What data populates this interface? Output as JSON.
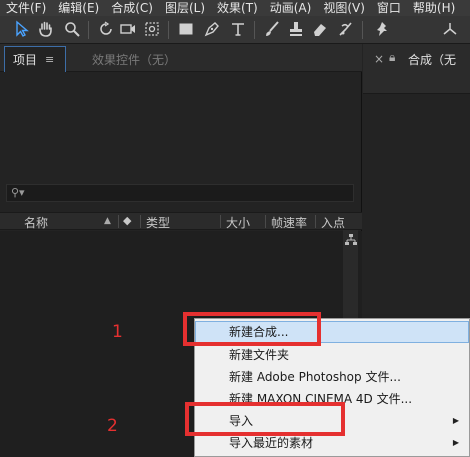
{
  "menubar": {
    "items": [
      {
        "label": "文件(F)"
      },
      {
        "label": "编辑(E)"
      },
      {
        "label": "合成(C)"
      },
      {
        "label": "图层(L)"
      },
      {
        "label": "效果(T)"
      },
      {
        "label": "动画(A)"
      },
      {
        "label": "视图(V)"
      },
      {
        "label": "窗口"
      },
      {
        "label": "帮助(H)"
      }
    ]
  },
  "toolbar": {
    "tools": [
      "selection-tool-icon",
      "hand-tool-icon",
      "zoom-tool-icon",
      "rotate-tool-icon",
      "camera-tool-icon",
      "pan-behind-tool-icon",
      "rectangle-tool-icon",
      "pen-tool-icon",
      "text-tool-icon",
      "brush-tool-icon",
      "clone-stamp-tool-icon",
      "eraser-tool-icon",
      "roto-brush-tool-icon",
      "puppet-pin-tool-icon",
      "axis-icon"
    ]
  },
  "project_panel": {
    "tab_project": "项目",
    "tab_effects": "效果控件（无）",
    "columns": {
      "name": "名称",
      "type": "类型",
      "size": "大小",
      "framerate": "帧速率",
      "inpoint": "入点"
    }
  },
  "comp_panel": {
    "tab_label": "合成（无"
  },
  "context_menu": {
    "items": [
      {
        "label": "新建合成..."
      },
      {
        "label": "新建文件夹"
      },
      {
        "label": "新建 Adobe Photoshop 文件..."
      },
      {
        "label": "新建 MAXON CINEMA 4D 文件..."
      },
      {
        "label": "导入"
      },
      {
        "label": "导入最近的素材"
      }
    ]
  },
  "annotations": {
    "step1": "1",
    "step2": "2"
  },
  "colors": {
    "accent": "#e53030",
    "highlight": "#cfe3f7",
    "panel_bg": "#232323"
  }
}
